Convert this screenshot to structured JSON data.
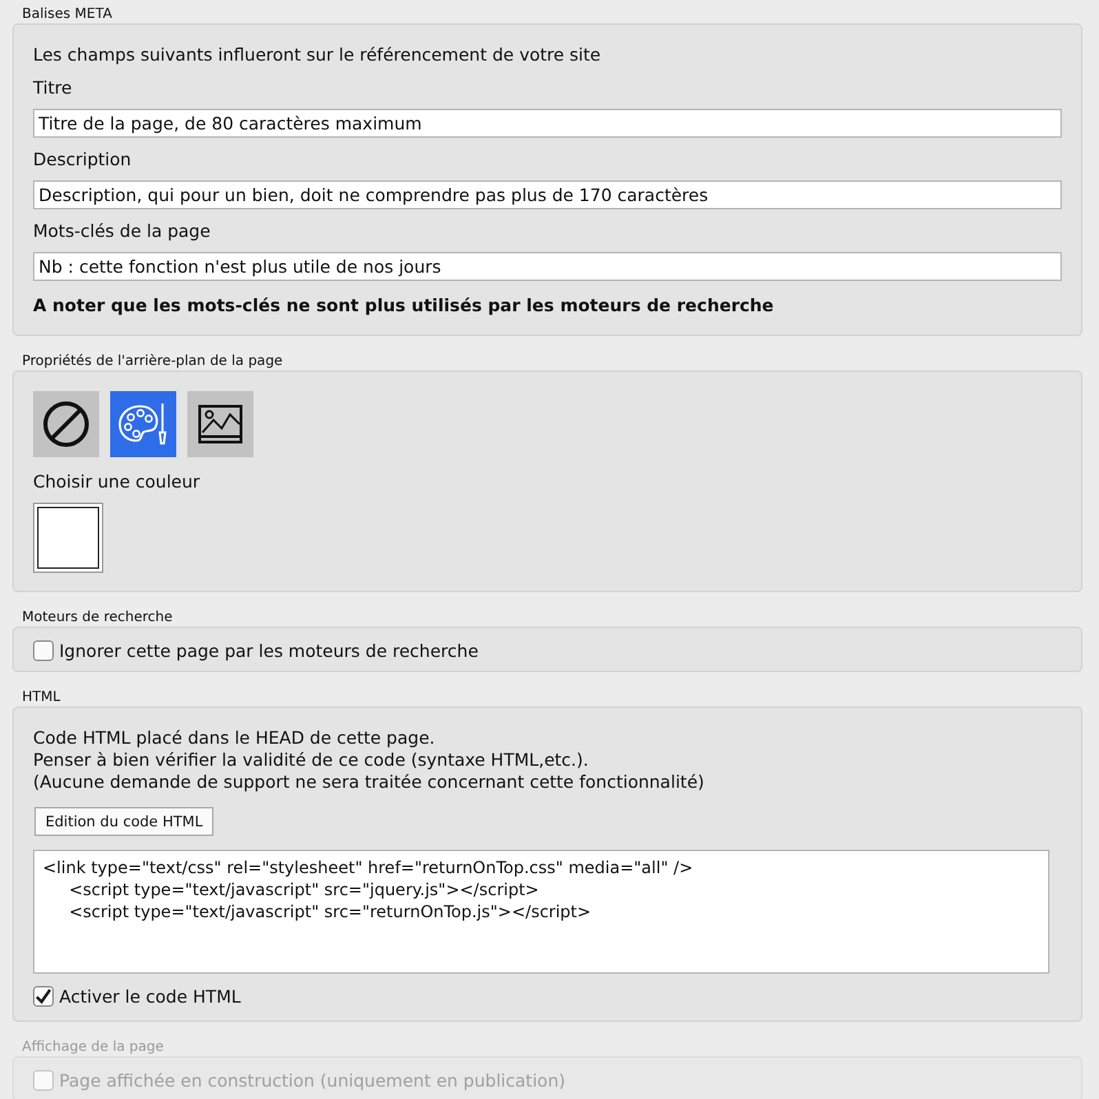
{
  "sections": [
    {
      "kind": "fields",
      "label": "Balises META",
      "disabled": false,
      "intro": "Les champs suivants influeront sur le référencement de votre site",
      "fields": [
        {
          "label": "Titre",
          "value": "Titre de la page, de 80 caractères maximum"
        },
        {
          "label": "Description",
          "value": "Description, qui pour un bien, doit ne comprendre pas plus de 170 caractères"
        },
        {
          "label": "Mots-clés de la page",
          "value": "Nb : cette fonction n'est plus utile de nos jours"
        }
      ],
      "note": "A noter que les mots-clés ne sont plus utilisés par les moteurs de recherche"
    },
    {
      "kind": "background",
      "label": "Propriétés de l'arrière-plan de la page",
      "disabled": false,
      "options": [
        {
          "kind": "none",
          "selected": false
        },
        {
          "kind": "color",
          "selected": true
        },
        {
          "kind": "image",
          "selected": false
        }
      ],
      "color_label": "Choisir une couleur"
    },
    {
      "kind": "checkbox",
      "label": "Moteurs de recherche",
      "disabled": false,
      "checkbox": {
        "label": "Ignorer cette page par les moteurs de recherche",
        "checked": false
      }
    },
    {
      "kind": "html",
      "label": "HTML",
      "disabled": false,
      "lines": [
        "Code HTML placé dans le HEAD de cette page.",
        "Penser à bien vérifier la validité de ce code (syntaxe HTML,etc.).",
        "(Aucune demande de support ne sera traitée concernant cette fonctionnalité)"
      ],
      "button": "Edition du code HTML",
      "code": [
        "<link type=\"text/css\" rel=\"stylesheet\" href=\"returnOnTop.css\" media=\"all\" />",
        "\t<script type=\"text/javascript\" src=\"jquery.js\"></script>",
        "\t<script type=\"text/javascript\" src=\"returnOnTop.js\"></script>"
      ],
      "checkbox": {
        "label": "Activer le code HTML",
        "checked": true
      }
    },
    {
      "kind": "checkbox",
      "label": "Affichage de la page",
      "disabled": true,
      "checkbox": {
        "label": "Page affichée en construction (uniquement en publication)",
        "checked": false
      }
    }
  ]
}
